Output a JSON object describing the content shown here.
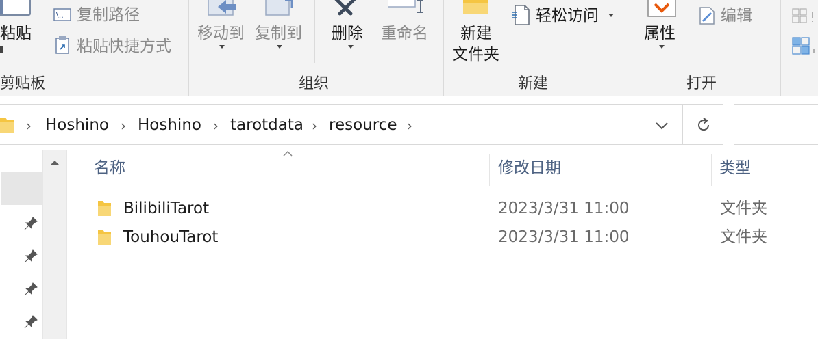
{
  "ribbon": {
    "clipboard": {
      "paste_label": "粘贴",
      "copy_path_label": "复制路径",
      "paste_shortcut_label": "粘贴快捷方式",
      "group_label": "剪贴板"
    },
    "organize": {
      "move_to_label": "移动到",
      "copy_to_label": "复制到",
      "delete_label": "删除",
      "rename_label": "重命名",
      "group_label": "组织"
    },
    "new": {
      "new_folder_line1": "新建",
      "new_folder_line2": "文件夹",
      "easy_access_label": "轻松访问",
      "group_label": "新建"
    },
    "open": {
      "properties_label": "属性",
      "edit_label": "编辑",
      "group_label": "打开"
    }
  },
  "address": {
    "crumbs": [
      "Hoshino",
      "Hoshino",
      "tarotdata",
      "resource"
    ]
  },
  "columns": {
    "name": "名称",
    "modified": "修改日期",
    "type": "类型"
  },
  "files": [
    {
      "name": "BilibiliTarot",
      "modified": "2023/3/31 11:00",
      "type": "文件夹"
    },
    {
      "name": "TouhouTarot",
      "modified": "2023/3/31 11:00",
      "type": "文件夹"
    }
  ],
  "colors": {
    "folder_yellow": "#f5c542",
    "ribbon_bg": "#f3f3f3",
    "header_text": "#4d6282",
    "accent_orange": "#e8590c"
  }
}
